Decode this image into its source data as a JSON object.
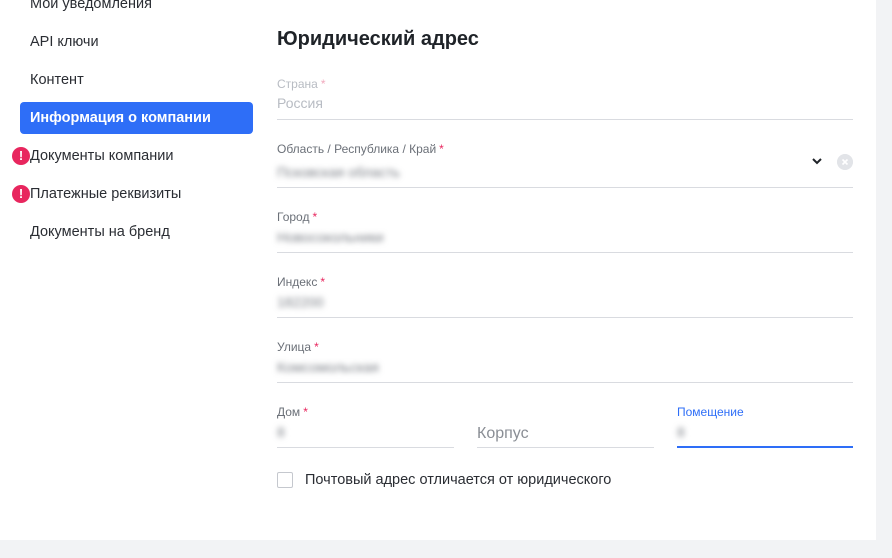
{
  "sidebar": {
    "items": [
      {
        "label": "Мои уведомления"
      },
      {
        "label": "API ключи"
      },
      {
        "label": "Контент"
      },
      {
        "label": "Информация о компании",
        "active": true
      },
      {
        "label": "Документы компании",
        "alert": "!"
      },
      {
        "label": "Платежные реквизиты",
        "alert": "!"
      },
      {
        "label": "Документы на бренд"
      }
    ]
  },
  "form": {
    "title": "Юридический адрес",
    "required_mark": "*",
    "country": {
      "label": "Страна",
      "value": "Россия"
    },
    "region": {
      "label": "Область / Республика / Край",
      "value": "Псковская область"
    },
    "city": {
      "label": "Город",
      "value": "Новосокольники"
    },
    "index": {
      "label": "Индекс",
      "value": "182200"
    },
    "street": {
      "label": "Улица",
      "value": "Комсомольская"
    },
    "house": {
      "label": "Дом",
      "value": "8"
    },
    "building": {
      "placeholder": "Корпус"
    },
    "room": {
      "label": "Помещение",
      "value": "8"
    },
    "postal_checkbox": {
      "label": "Почтовый адрес отличается от юридического",
      "checked": false
    }
  },
  "colors": {
    "accent": "#2e6ef7",
    "alert": "#e8265e"
  }
}
